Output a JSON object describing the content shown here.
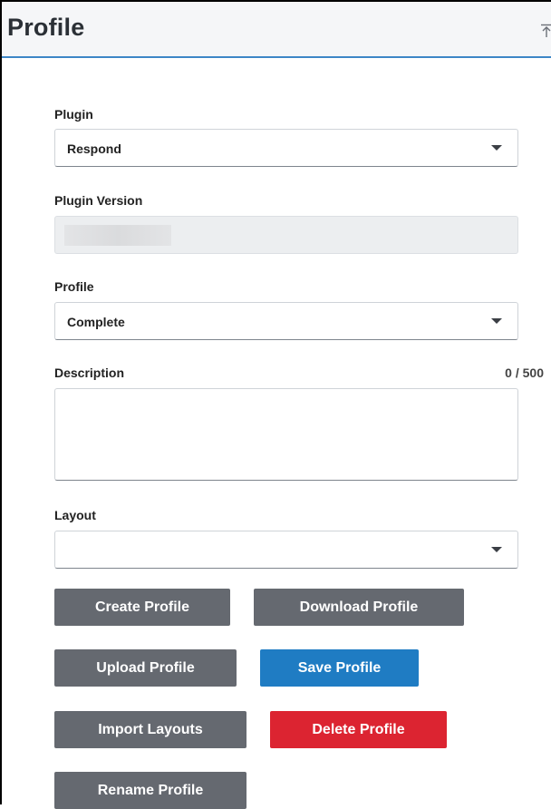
{
  "header": {
    "title": "Profile"
  },
  "fields": {
    "plugin": {
      "label": "Plugin",
      "value": "Respond"
    },
    "plugin_version": {
      "label": "Plugin Version"
    },
    "profile": {
      "label": "Profile",
      "value": "Complete"
    },
    "description": {
      "label": "Description",
      "counter": "0 / 500",
      "value": ""
    },
    "layout": {
      "label": "Layout",
      "value": ""
    }
  },
  "buttons": {
    "create_profile": "Create Profile",
    "download_profile": "Download Profile",
    "upload_profile": "Upload Profile",
    "save_profile": "Save Profile",
    "import_layouts": "Import Layouts",
    "delete_profile": "Delete Profile",
    "rename_profile": "Rename Profile"
  },
  "colors": {
    "header_accent": "#3d86c6",
    "button_gray": "#656970",
    "button_blue": "#1f7cc3",
    "button_red": "#dc2431"
  },
  "icons": {
    "collapse": "collapse-up-icon",
    "dropdown": "chevron-down-icon"
  }
}
